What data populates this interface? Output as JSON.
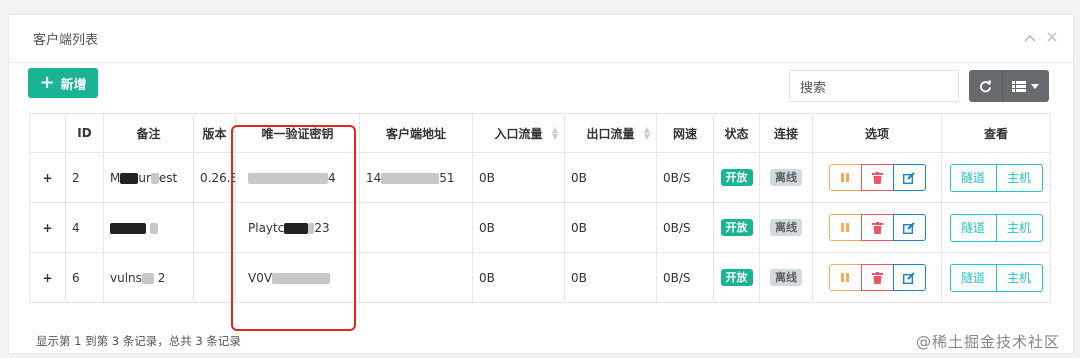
{
  "panel": {
    "title": "客户端列表",
    "collapse_icon": "chevron-up",
    "close_icon": "close"
  },
  "toolbar": {
    "add_label": "新增",
    "search_placeholder": "搜索"
  },
  "table": {
    "columns": [
      "ID",
      "备注",
      "版本",
      "唯一验证密钥",
      "客户端地址",
      "入口流量",
      "出口流量",
      "网速",
      "状态",
      "连接",
      "选项",
      "查看"
    ],
    "rows": [
      {
        "id": "2",
        "remark_a": "M",
        "remark_b": "ur",
        "remark_c": "est",
        "version": "0.26.8",
        "key_a": "",
        "key_b": "4",
        "addr_a": "14",
        "addr_b": "51",
        "in": "0B",
        "out": "0B",
        "speed": "0B/S",
        "status": "开放",
        "conn": "离线"
      },
      {
        "id": "4",
        "remark_a": "",
        "remark_b": "",
        "remark_c": "",
        "version": "",
        "key_a": "Playtc",
        "key_b": "23",
        "addr_a": "",
        "addr_b": "",
        "in": "0B",
        "out": "0B",
        "speed": "0B/S",
        "status": "开放",
        "conn": "离线"
      },
      {
        "id": "6",
        "remark_a": "vulns",
        "remark_b": "2",
        "remark_c": "",
        "version": "",
        "key_a": "V0V",
        "key_b": "",
        "addr_a": "",
        "addr_b": "",
        "in": "0B",
        "out": "0B",
        "speed": "0B/S",
        "status": "开放",
        "conn": "离线"
      }
    ],
    "view_buttons": [
      "隧道",
      "主机"
    ]
  },
  "footer": {
    "info": "显示第 1 到第 3 条记录，总共 3 条记录"
  },
  "watermark": "@稀土掘金技术社区",
  "colors": {
    "primary": "#1ab394",
    "warning": "#f8ac59",
    "danger": "#ed5565",
    "info": "#1c84c6",
    "tunnel": "#23c6c8",
    "highlight": "#e0291c"
  }
}
